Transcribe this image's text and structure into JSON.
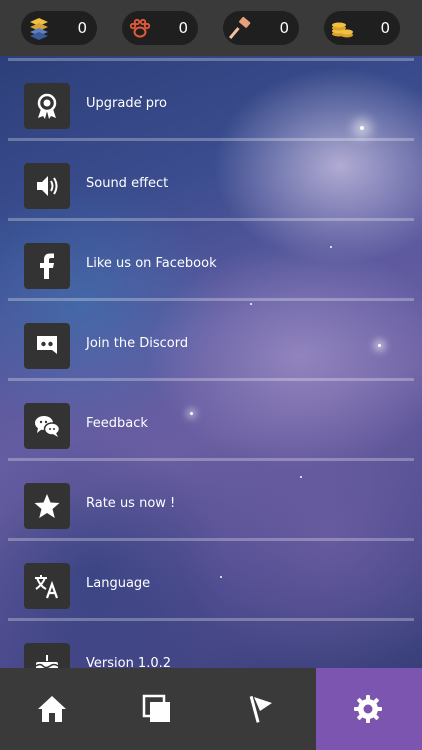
{
  "resources": [
    {
      "icon": "layers-icon",
      "value": "0"
    },
    {
      "icon": "paw-icon",
      "value": "0"
    },
    {
      "icon": "hammer-icon",
      "value": "0"
    },
    {
      "icon": "coins-icon",
      "value": "0"
    }
  ],
  "settings": {
    "items": [
      {
        "icon": "medal-icon",
        "label": "Upgrade pro"
      },
      {
        "icon": "speaker-icon",
        "label": "Sound effect"
      },
      {
        "icon": "facebook-icon",
        "label": "Like us on Facebook"
      },
      {
        "icon": "discord-icon",
        "label": "Join the Discord"
      },
      {
        "icon": "chat-icon",
        "label": "Feedback"
      },
      {
        "icon": "star-icon",
        "label": "Rate us now !"
      },
      {
        "icon": "translate-icon",
        "label": "Language"
      },
      {
        "icon": "cake-icon",
        "label": "Version 1.0.2"
      }
    ]
  },
  "nav": {
    "tabs": [
      {
        "icon": "home-icon",
        "active": false
      },
      {
        "icon": "cards-icon",
        "active": false
      },
      {
        "icon": "flag-icon",
        "active": false
      },
      {
        "icon": "gear-icon",
        "active": true
      }
    ],
    "active_color": "#7b55b0"
  }
}
